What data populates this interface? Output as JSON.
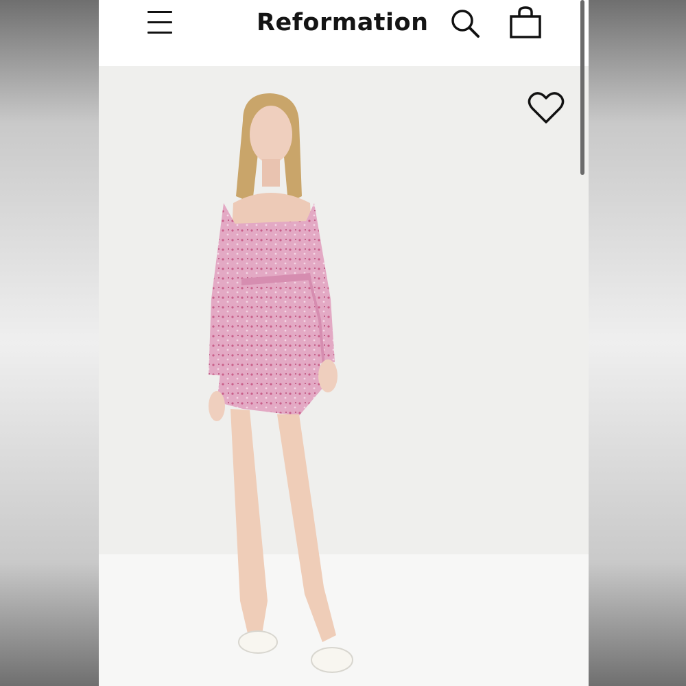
{
  "header": {
    "brand": "Reformation",
    "icons": {
      "menu": "hamburger-menu-icon",
      "search": "search-icon",
      "bag": "shopping-bag-icon"
    }
  },
  "product": {
    "image_description_icon": "product-photo",
    "wishlist_icon": "heart-icon"
  },
  "colors": {
    "header_bg": "#ffffff",
    "text": "#141414",
    "photo_bg": "#efefed",
    "dress_pink": "#dfa0bd"
  }
}
